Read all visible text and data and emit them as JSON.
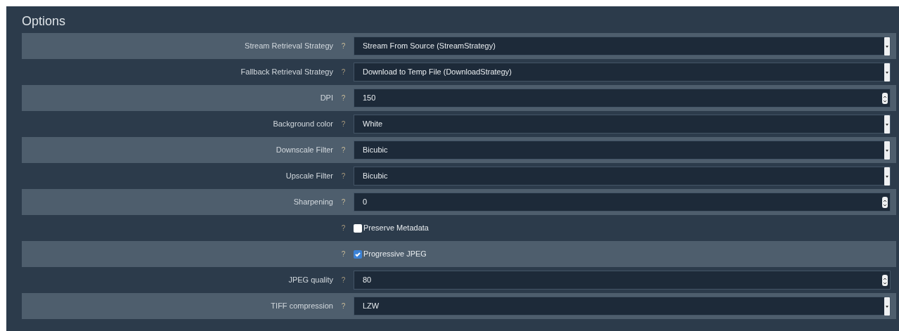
{
  "title": "Options",
  "rows": [
    {
      "kind": "select",
      "label": "Stream Retrieval Strategy",
      "help": "?",
      "value": "Stream From Source (StreamStrategy)"
    },
    {
      "kind": "select",
      "label": "Fallback Retrieval Strategy",
      "help": "?",
      "value": "Download to Temp File (DownloadStrategy)"
    },
    {
      "kind": "number",
      "label": "DPI",
      "help": "?",
      "value": "150"
    },
    {
      "kind": "select",
      "label": "Background color",
      "help": "?",
      "value": "White"
    },
    {
      "kind": "select",
      "label": "Downscale Filter",
      "help": "?",
      "value": "Bicubic"
    },
    {
      "kind": "select",
      "label": "Upscale Filter",
      "help": "?",
      "value": "Bicubic"
    },
    {
      "kind": "number",
      "label": "Sharpening",
      "help": "?",
      "value": "0"
    },
    {
      "kind": "checkbox",
      "help": "?",
      "value": "Preserve Metadata",
      "checked": false
    },
    {
      "kind": "checkbox",
      "help": "?",
      "value": "Progressive JPEG",
      "checked": true
    },
    {
      "kind": "number",
      "label": "JPEG quality",
      "help": "?",
      "value": "80"
    },
    {
      "kind": "select",
      "label": "TIFF compression",
      "help": "?",
      "value": "LZW"
    }
  ]
}
